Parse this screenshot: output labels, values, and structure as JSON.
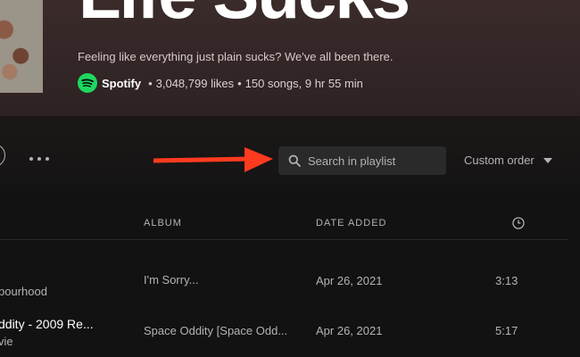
{
  "header": {
    "title": "Life Sucks",
    "description": "Feeling like everything just plain sucks? We've all been there.",
    "owner": "Spotify",
    "likes": "3,048,799 likes",
    "songs": "150 songs, 9 hr 55 min"
  },
  "toolbar": {
    "search_placeholder": "Search in playlist",
    "sort_label": "Custom order"
  },
  "columns": {
    "album": "ALBUM",
    "date_added": "DATE ADDED"
  },
  "tracks": [
    {
      "title": "",
      "artist": "bourhood",
      "album": "I'm Sorry...",
      "date_added": "Apr 26, 2021",
      "duration": "3:13"
    },
    {
      "title": "ddity - 2009 Re...",
      "artist": "vie",
      "album": "Space Oddity [Space Odd...",
      "date_added": "Apr 26, 2021",
      "duration": "5:17"
    }
  ],
  "colors": {
    "brand": "#1ed760",
    "annotation_arrow": "#ff3b1f"
  },
  "icons": {
    "search": "search-icon",
    "clock": "clock-icon",
    "more": "more-horizontal-icon",
    "logo": "spotify-logo"
  }
}
